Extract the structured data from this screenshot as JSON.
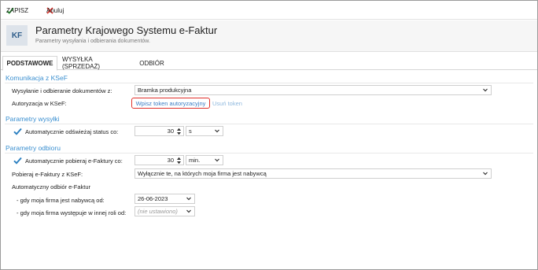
{
  "toolbar": {
    "save_label": "ZAPISZ",
    "cancel_label": "Anuluj"
  },
  "header": {
    "badge": "KF",
    "title": "Parametry Krajowego Systemu e-Faktur",
    "subtitle": "Parametry wysyłania i odbierania dokumentów."
  },
  "tabs": [
    {
      "label": "PODSTAWOWE",
      "active": true
    },
    {
      "label": "WYSYŁKA (SPRZEDAŻ)",
      "active": false
    },
    {
      "label": "ODBIÓR",
      "active": false
    }
  ],
  "ksef": {
    "section_title": "Komunikacja z KSeF",
    "send_receive_label": "Wysyłanie i odbieranie dokumentów z:",
    "send_receive_value": "Bramka produkcyjna",
    "auth_label": "Autoryzacja w KSeF:",
    "auth_link": "Wpisz token autoryzacyjny",
    "remove_token_link": "Usuń token"
  },
  "sending": {
    "section_title": "Parametry wysyłki",
    "auto_refresh_label": "Automatycznie odświeżaj status co:",
    "auto_refresh_checked": true,
    "auto_refresh_value": "30",
    "auto_refresh_unit": "s"
  },
  "receiving": {
    "section_title": "Parametry odbioru",
    "auto_fetch_label": "Automatycznie pobieraj e-Faktury co:",
    "auto_fetch_checked": true,
    "auto_fetch_value": "30",
    "auto_fetch_unit": "min.",
    "fetch_from_label": "Pobieraj e-Faktury z KSeF:",
    "fetch_from_value": "Wyłącznie te, na których moja firma jest nabywcą",
    "auto_receive_label": "Automatyczny odbiór e-Faktur",
    "buyer_label": "- gdy moja firma jest nabywcą od:",
    "buyer_date": "26-06-2023",
    "other_role_label": "- gdy moja firma występuje w innej roli od:",
    "other_role_placeholder": "(nie ustawiono)"
  },
  "colors": {
    "accent": "#3a8fd0",
    "save_green": "#2e9e3a",
    "cancel_red": "#d9302a",
    "highlight_red": "#e0302a"
  }
}
